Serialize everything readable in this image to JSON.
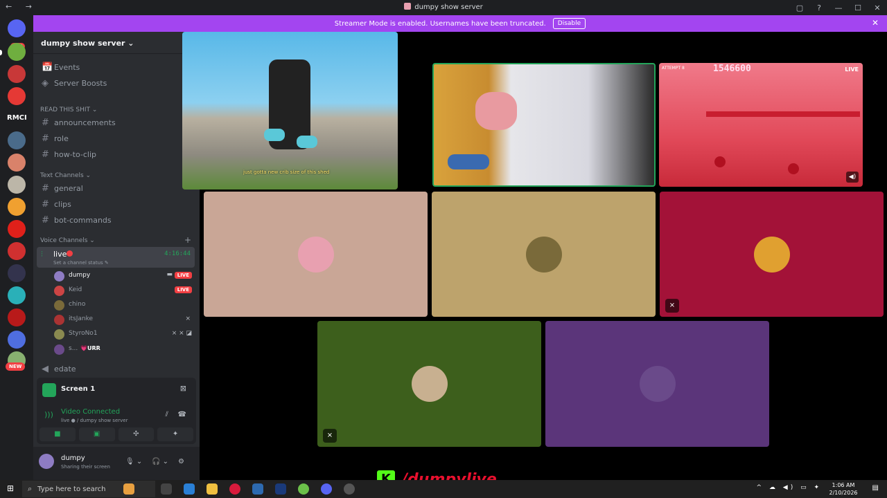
{
  "window": {
    "title": "dumpy show server",
    "nav": "← →",
    "controls": [
      "▢",
      "?",
      "—",
      "☐",
      "✕"
    ]
  },
  "rail": {
    "badge": "685",
    "text_server": "RMCI",
    "new_badge": "NEW"
  },
  "banner": {
    "text": "Streamer Mode is enabled. Usernames have been truncated.",
    "button": "Disable",
    "close": "✕"
  },
  "sidebar": {
    "server_name": "dumpy show server ⌄",
    "items": [
      {
        "icon": "📅",
        "label": "Events"
      },
      {
        "icon": "◈",
        "label": "Server Boosts"
      }
    ],
    "categories": {
      "read": "READ THIS SHIT ⌄",
      "text": "Text Channels ⌄",
      "voice": "Voice Channels ⌄"
    },
    "read_channels": [
      "announcements",
      "role",
      "how-to-clip"
    ],
    "text_channels": [
      "general",
      "clips",
      "bot-commands"
    ],
    "voice_channel": {
      "name": "live",
      "timer": "4:16:44",
      "status": "Set a channel status ✎"
    },
    "voice_users": [
      {
        "name": "dumpy",
        "live": "LIVE",
        "camera": "▬"
      },
      {
        "name": "Keid",
        "live": "LIVE"
      },
      {
        "name": "chino"
      },
      {
        "name": "itsJanke",
        "icons": "⨯"
      },
      {
        "name": "StyroNo1",
        "icons": "⨯ ⨯ ◪"
      },
      {
        "name": "s...",
        "sub": "💗URR"
      }
    ],
    "other_voice": "edate"
  },
  "rtc": {
    "screen_label": "Screen 1",
    "title": "Video Connected",
    "subtitle": "live ● / dumpy show server",
    "buttons": [
      "■",
      "▣",
      "✣",
      "✦"
    ]
  },
  "user_panel": {
    "name": "dumpy",
    "status": "Sharing their screen",
    "controls": [
      "🎙 ⌄",
      "🎧 ⌄",
      "⚙"
    ]
  },
  "stage": {
    "caption": "just gotta new crib size of this shed",
    "game_attempt": "ATTEMPT 8",
    "game_score": "1546600",
    "live_tag": "LIVE",
    "speaker": "◀)",
    "muted_icon": "⨯"
  },
  "brand": {
    "k": "K",
    "handle": "/dumpylive"
  },
  "taskbar": {
    "start": "⊞",
    "search_placeholder": "Type here to search",
    "time": "1:06 AM",
    "date": "2/10/2026",
    "tray": "^ ☁ ◀) ▭ ✦",
    "notif": "▤"
  },
  "colors": {
    "accent": "#a345f0",
    "green": "#23a55a",
    "red": "#f23f43"
  }
}
